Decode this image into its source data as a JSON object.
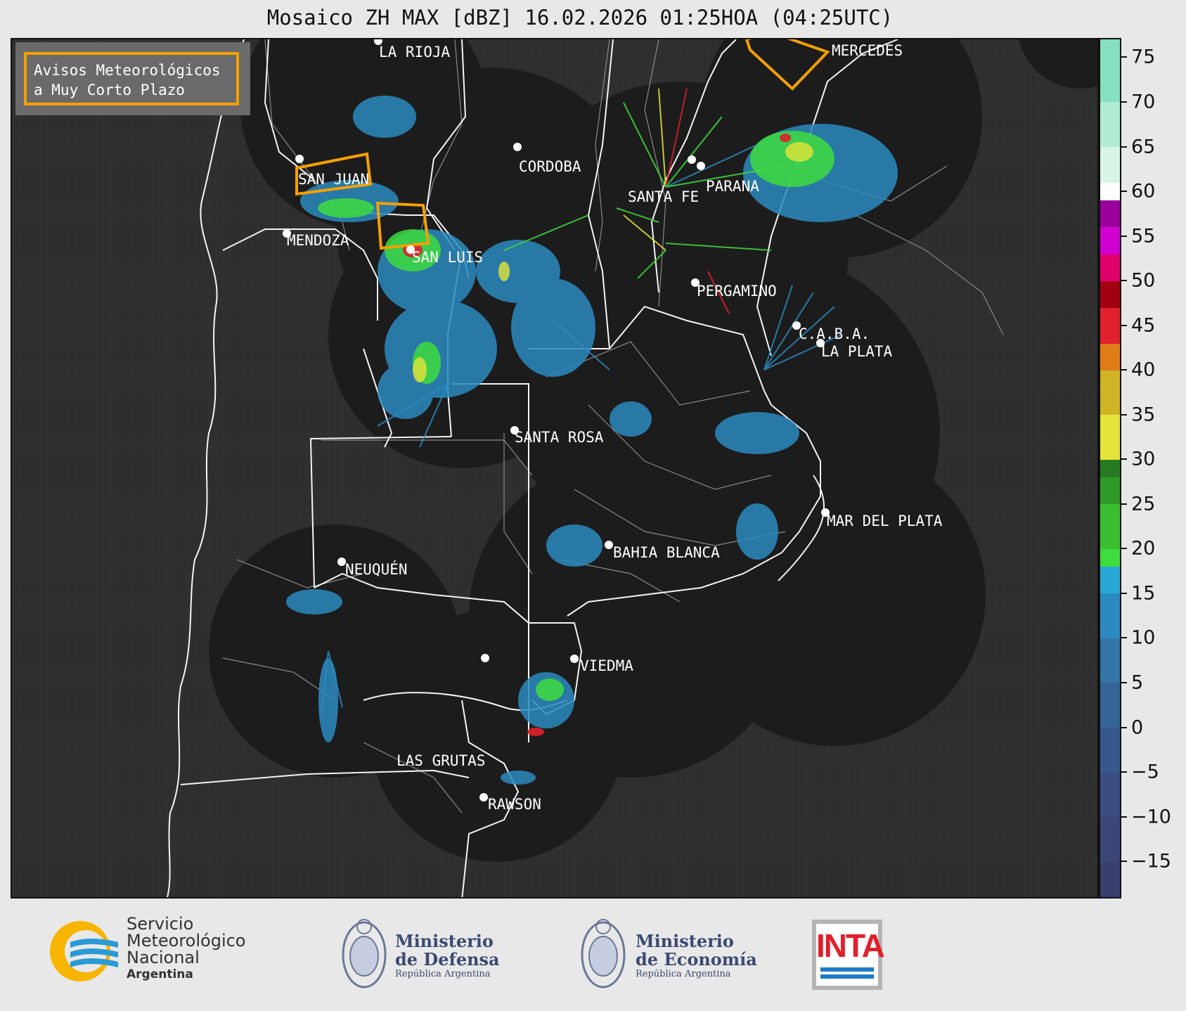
{
  "title": "Mosaico ZH MAX [dBZ] 16.02.2026 01:25HOA (04:25UTC)",
  "legend": {
    "line1": "Avisos Meteorológicos",
    "line2": "a Muy Corto Plazo"
  },
  "cities": [
    {
      "name": "LA RIOJA"
    },
    {
      "name": "CORDOBA"
    },
    {
      "name": "SAN JUAN"
    },
    {
      "name": "SANTA FE"
    },
    {
      "name": "PARANA"
    },
    {
      "name": "MERCEDES"
    },
    {
      "name": "MENDOZA"
    },
    {
      "name": "SAN LUIS"
    },
    {
      "name": "PERGAMINO"
    },
    {
      "name": "C.A.B.A."
    },
    {
      "name": "LA PLATA"
    },
    {
      "name": "SANTA ROSA"
    },
    {
      "name": "MAR DEL PLATA"
    },
    {
      "name": "BAHIA BLANCA"
    },
    {
      "name": "NEUQUÉN"
    },
    {
      "name": "LAS GRUTAS"
    },
    {
      "name": "VIEDMA"
    },
    {
      "name": "RAWSON"
    }
  ],
  "colorbar": {
    "unit": "dBZ",
    "min": -19,
    "max": 77,
    "tick_labels": [
      "75",
      "70",
      "65",
      "60",
      "55",
      "50",
      "45",
      "40",
      "35",
      "30",
      "25",
      "20",
      "15",
      "10",
      "5",
      "0",
      "−5",
      "−10",
      "−15"
    ],
    "tick_values": [
      75,
      70,
      65,
      60,
      55,
      50,
      45,
      40,
      35,
      30,
      25,
      20,
      15,
      10,
      5,
      0,
      -5,
      -10,
      -15
    ],
    "bands": [
      {
        "from": -19,
        "to": -15,
        "color": "#3a3f6e"
      },
      {
        "from": -15,
        "to": -10,
        "color": "#3b4577"
      },
      {
        "from": -10,
        "to": -5,
        "color": "#3a4e82"
      },
      {
        "from": -5,
        "to": 0,
        "color": "#37588d"
      },
      {
        "from": 0,
        "to": 5,
        "color": "#356497"
      },
      {
        "from": 5,
        "to": 10,
        "color": "#3475a8"
      },
      {
        "from": 10,
        "to": 15,
        "color": "#2c8ac0"
      },
      {
        "from": 15,
        "to": 18,
        "color": "#29a8d8"
      },
      {
        "from": 18,
        "to": 20,
        "color": "#3edc3e"
      },
      {
        "from": 20,
        "to": 25,
        "color": "#3bbf30"
      },
      {
        "from": 25,
        "to": 28,
        "color": "#2f9a28"
      },
      {
        "from": 28,
        "to": 30,
        "color": "#277a22"
      },
      {
        "from": 30,
        "to": 35,
        "color": "#e4e43a"
      },
      {
        "from": 35,
        "to": 40,
        "color": "#cfb526"
      },
      {
        "from": 40,
        "to": 43,
        "color": "#e07c18"
      },
      {
        "from": 43,
        "to": 47,
        "color": "#e0202c"
      },
      {
        "from": 47,
        "to": 50,
        "color": "#a00010"
      },
      {
        "from": 50,
        "to": 53,
        "color": "#e0006a"
      },
      {
        "from": 53,
        "to": 56,
        "color": "#d000d0"
      },
      {
        "from": 56,
        "to": 59,
        "color": "#9a009a"
      },
      {
        "from": 59,
        "to": 61,
        "color": "#ffffff"
      },
      {
        "from": 61,
        "to": 65,
        "color": "#d8f5e8"
      },
      {
        "from": 65,
        "to": 70,
        "color": "#b0ecd4"
      },
      {
        "from": 70,
        "to": 77,
        "color": "#86dfbf"
      }
    ]
  },
  "logos": {
    "smn_line1": "Servicio",
    "smn_line2": "Meteorológico",
    "smn_line3": "Nacional",
    "smn_line4": "Argentina",
    "defensa_line1": "Ministerio",
    "defensa_line2": "de Defensa",
    "defensa_line3": "República Argentina",
    "economia_line1": "Ministerio",
    "economia_line2": "de Economía",
    "economia_line3": "República Argentina",
    "inta": "INTA"
  },
  "colors": {
    "warning_polygon": "#f5a000",
    "radar_disc": "#1c1c1c",
    "background_land": "#2e2e2e"
  }
}
